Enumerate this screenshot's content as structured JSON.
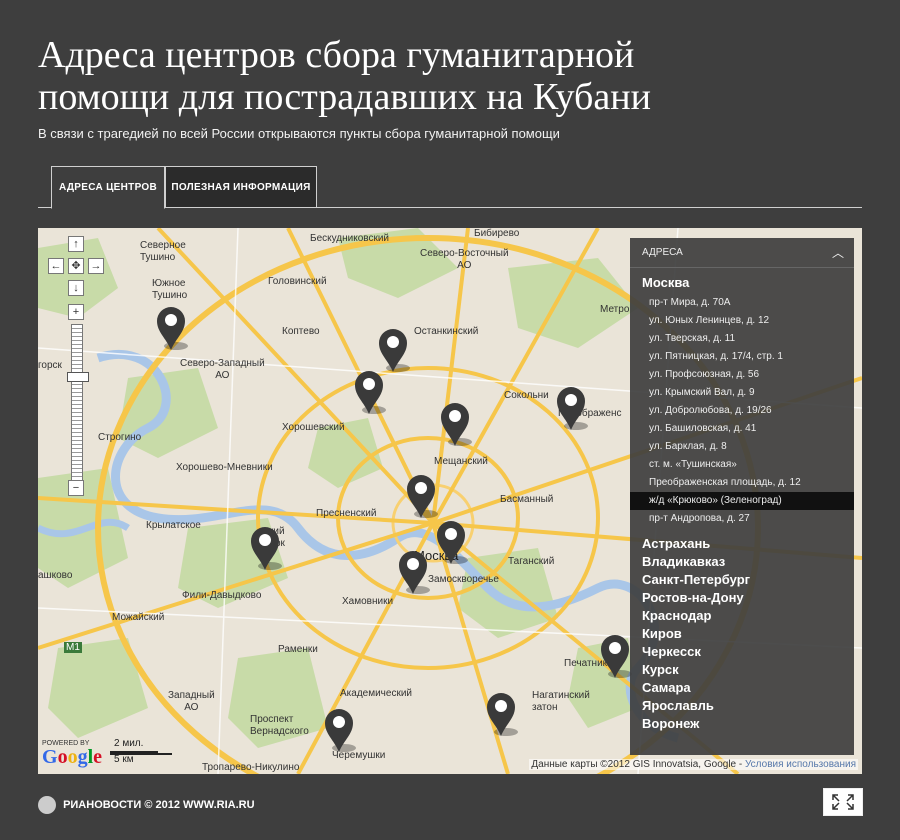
{
  "header": {
    "title_line1": "Адреса центров сбора гуманитарной",
    "title_line2": "помощи для пострадавших на Кубани",
    "subtitle": "В связи с трагедией по всей России открываются пункты сбора гуманитарной помощи"
  },
  "tabs": [
    "АДРЕСА ЦЕНТРОВ",
    "ПОЛЕЗНАЯ ИНФОРМАЦИЯ"
  ],
  "map": {
    "labels": {
      "north_tushino": "Северное\nТушино",
      "beskudnikovsky": "Бескудниковский",
      "bibirevo": "Бибирево",
      "yuzhnoe_tushino": "Южное\nТушино",
      "severo_vostochny": "Северо-Восточный\nАО",
      "golovinsky": "Головинский",
      "koptevo": "Коптево",
      "ostankinsky": "Останкинский",
      "metrogorodok": "Метро",
      "severo_zapadny": "Северо-Западный\nАО",
      "sokolniki": "Сокольни",
      "preobrazhenskoe": "Преображенс",
      "gorsk": "горск",
      "khoroshevsky": "Хорошевский",
      "strogino": "Строгино",
      "meshchansky": "Мещанский",
      "khoroshevo": "Хорошево-Мневники",
      "basmanny": "Басманный",
      "krylatskoe": "Крылатское",
      "presnensky": "Пресненский",
      "park": "ский\nпарк",
      "moskva": "Москва",
      "tagansky": "Таганский",
      "zamoskvorechye": "Замоскворечье",
      "fili": "Фили-Давыдково",
      "khamovniki": "Хамовники",
      "mozhaysky": "Можайский",
      "ramenki": "Раменки",
      "pechatniki": "Печатники",
      "zapadny": "Западный\nАО",
      "akademichesky": "Академический",
      "nagatinsky": "Нагатинский\nзатон",
      "prospekt_vernadskogo": "Проспект\nВернадского",
      "cheremushki": "Черемушки",
      "troparevo": "Тропарево-Никулино",
      "mozhaysk_short": "ашково",
      "m1": "M1"
    },
    "scale_top": "2 мил.",
    "scale_bottom": "5 км",
    "powered_by": "POWERED BY",
    "google": "Google",
    "credits": "Данные карты ©2012 GIS Innovatsia, Google -",
    "terms_link": "Условия использования"
  },
  "panel": {
    "header": "АДРЕСА",
    "chevron": "︿",
    "moscow": "Москва",
    "addresses": [
      "пр-т Мира, д. 70А",
      "ул. Юных Ленинцев, д. 12",
      "ул. Тверская, д. 11",
      "ул. Пятницкая, д. 17/4, стр. 1",
      "ул. Профсоюзная, д. 56",
      "ул. Крымский Вал, д. 9",
      "ул. Добролюбова, д. 19/26",
      "ул. Башиловская, д. 41",
      "ул. Барклая, д. 8",
      "ст. м. «Тушинская»",
      "Преображенская площадь, д. 12",
      "ж/д «Крюково» (Зеленоград)",
      "пр-т Андропова, д. 27"
    ],
    "selected_index": 11,
    "cities": [
      "Астрахань",
      "Владикавказ",
      "Санкт-Петербург",
      "Ростов-на-Дону",
      "Краснодар",
      "Киров",
      "Черкесск",
      "Курск",
      "Самара",
      "Ярославль",
      "Воронеж"
    ]
  },
  "footer": {
    "logo_text": "РИАНОВОСТИ",
    "copyright": "© 2012 WWW.RIA.RU"
  },
  "colors": {
    "background": "#3e3e3e",
    "panel": "#3e3e3e",
    "road_major": "#f6c64a",
    "pin": "#3a3a3a"
  }
}
